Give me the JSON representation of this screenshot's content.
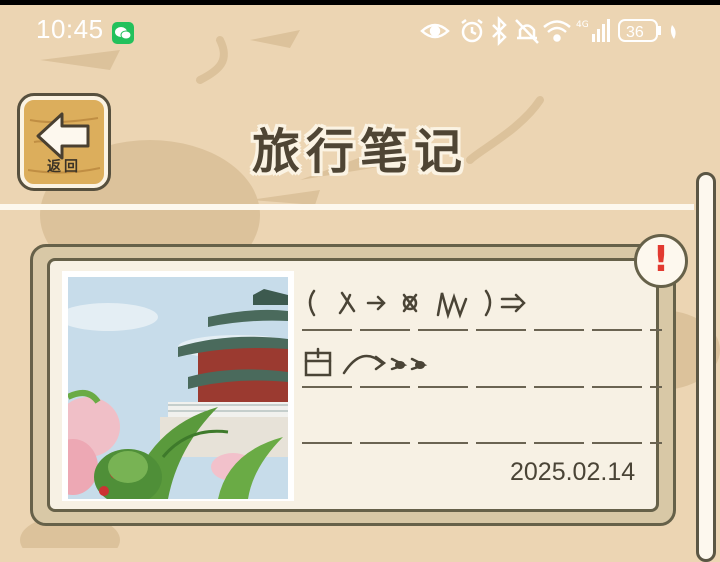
{
  "status_bar": {
    "time": "10:45",
    "network": "4G",
    "battery": "36"
  },
  "header": {
    "back_label": "返回",
    "title": "旅行笔记"
  },
  "card": {
    "date": "2025.02.14",
    "alert": "!"
  },
  "colors": {
    "background": "#ecd5b3",
    "text": "#4f4534",
    "card_border": "#666149",
    "alert_red": "#e23a30",
    "wood": "#dcae5c"
  },
  "icons": [
    "wechat-icon",
    "eye-icon",
    "alarm-icon",
    "bluetooth-icon",
    "mute-icon",
    "wifi-icon",
    "signal-icon",
    "battery-icon",
    "back-arrow-icon",
    "alert-icon"
  ]
}
